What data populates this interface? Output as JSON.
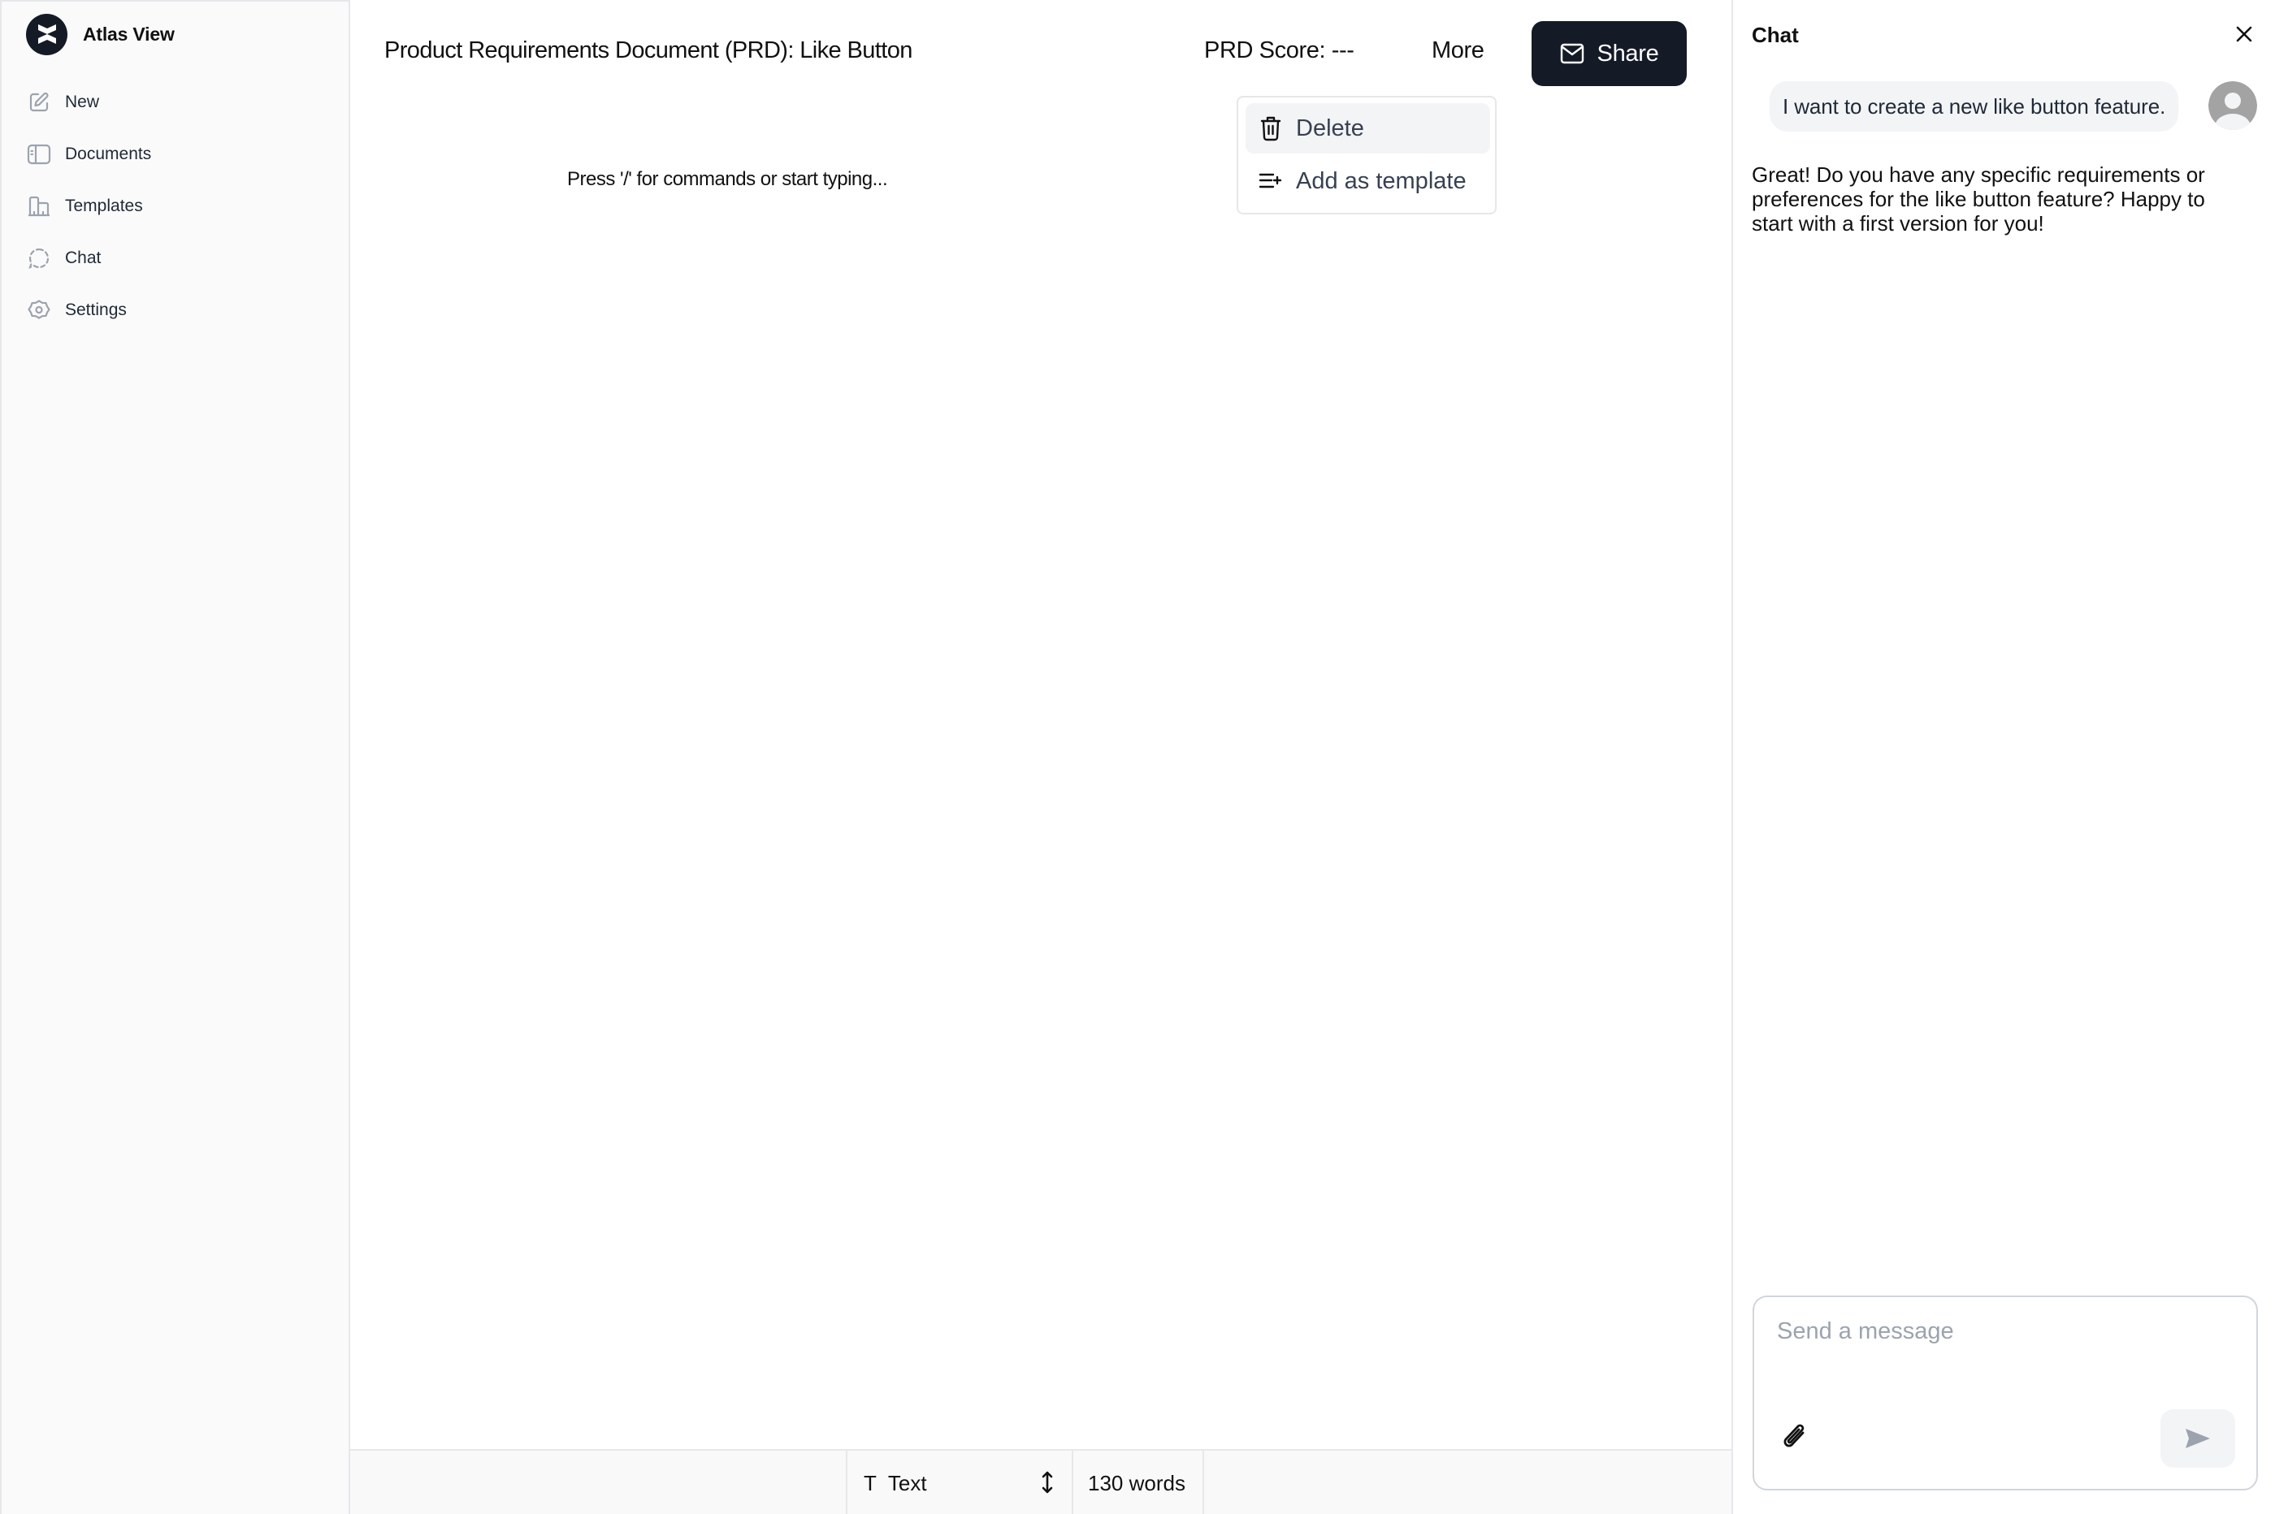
{
  "app": {
    "name": "Atlas View",
    "logo_icon": "atlas-logo-icon"
  },
  "sidebar": {
    "items": [
      {
        "label": "New",
        "icon": "edit-icon"
      },
      {
        "label": "Documents",
        "icon": "documents-icon"
      },
      {
        "label": "Templates",
        "icon": "templates-icon"
      },
      {
        "label": "Chat",
        "icon": "chat-icon"
      },
      {
        "label": "Settings",
        "icon": "settings-icon"
      }
    ]
  },
  "header": {
    "title": "Product Requirements Document (PRD): Like Button",
    "prd_score": "PRD Score: ---",
    "more_label": "More",
    "share_label": "Share",
    "share_icon": "mail-icon"
  },
  "more_menu": {
    "items": [
      {
        "label": "Delete",
        "icon": "trash-icon",
        "highlighted": true
      },
      {
        "label": "Add as template",
        "icon": "list-add-icon",
        "highlighted": false
      }
    ]
  },
  "editor": {
    "placeholder": "Press '/' for commands or start typing..."
  },
  "footer": {
    "block_type_glyph": "T",
    "block_type": "Text",
    "word_count": "130 words"
  },
  "chat": {
    "title": "Chat",
    "messages": [
      {
        "role": "user",
        "text": "I want to create a new like button feature."
      },
      {
        "role": "assistant",
        "text": "Great! Do you have any specific requirements or preferences for the like button feature? Happy to start with a first version for you!"
      }
    ],
    "input_placeholder": "Send a message",
    "input_value": ""
  },
  "colors": {
    "primary_dark": "#151a27",
    "sidebar_bg": "#fafafa",
    "menu_highlight": "#f3f4f6",
    "border": "#e5e7eb"
  }
}
